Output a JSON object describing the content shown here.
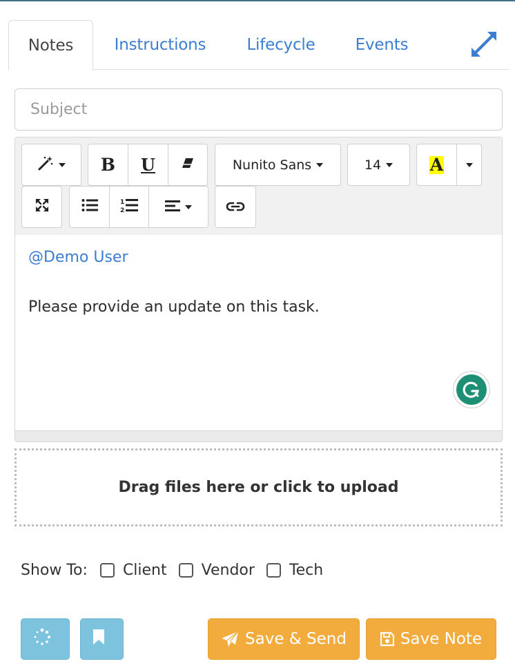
{
  "tabs": [
    {
      "label": "Notes",
      "active": true
    },
    {
      "label": "Instructions",
      "active": false
    },
    {
      "label": "Lifecycle",
      "active": false
    },
    {
      "label": "Events",
      "active": false
    }
  ],
  "expand_icon": "expand-arrows-icon",
  "subject": {
    "placeholder": "Subject",
    "value": ""
  },
  "toolbar": {
    "style_icon": "magic-wand-icon",
    "bold_label": "B",
    "underline_label": "U",
    "eraser_icon": "eraser-icon",
    "font_family": "Nunito Sans",
    "font_size": "14",
    "color_label": "A",
    "highlight_color": "#ffff00",
    "fullscreen_icon": "fullscreen-icon",
    "bullet_list_icon": "unordered-list-icon",
    "numbered_list_icon": "ordered-list-icon",
    "align_icon": "align-left-icon",
    "link_icon": "link-icon"
  },
  "editor": {
    "mention": "@Demo User",
    "body": "Please provide an update on this task."
  },
  "dropzone": {
    "label": "Drag files here or click to upload"
  },
  "show_to": {
    "label": "Show To:",
    "options": [
      {
        "label": "Client",
        "checked": false
      },
      {
        "label": "Vendor",
        "checked": false
      },
      {
        "label": "Tech",
        "checked": false
      }
    ]
  },
  "footer": {
    "save_send_label": "Save & Send",
    "save_note_label": "Save Note"
  },
  "colors": {
    "link_blue": "#3b7dd0",
    "action_orange": "#f2ac3e",
    "info_blue": "#7ec3dd",
    "grammarly_green": "#1d8f74"
  }
}
